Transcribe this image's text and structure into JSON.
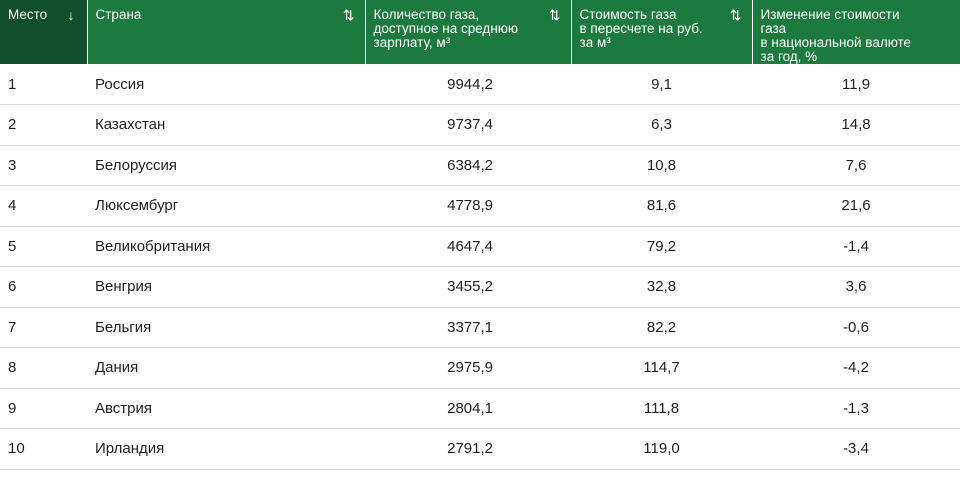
{
  "chart_data": {
    "type": "table",
    "columns": [
      {
        "label": "Место",
        "icon": "arrow-down-icon"
      },
      {
        "label": "Страна",
        "icon": "sort-arrows-icon"
      },
      {
        "label": "Количество газа,\nдоступное на среднюю\nзарплату, м³",
        "icon": "sort-arrows-icon"
      },
      {
        "label": "Стоимость газа\nв пересчете на руб.\nза м³",
        "icon": "sort-arrows-icon"
      },
      {
        "label": "Изменение стоимости газа\nв национальной валюте\nза год, %",
        "icon": ""
      }
    ],
    "rows": [
      [
        "1",
        "Россия",
        "9944,2",
        "9,1",
        "11,9"
      ],
      [
        "2",
        "Казахстан",
        "9737,4",
        "6,3",
        "14,8"
      ],
      [
        "3",
        "Белоруссия",
        "6384,2",
        "10,8",
        "7,6"
      ],
      [
        "4",
        "Люксембург",
        "4778,9",
        "81,6",
        "21,6"
      ],
      [
        "5",
        "Великобритания",
        "4647,4",
        "79,2",
        "-1,4"
      ],
      [
        "6",
        "Венгрия",
        "3455,2",
        "32,8",
        "3,6"
      ],
      [
        "7",
        "Бельгия",
        "3377,1",
        "82,2",
        "-0,6"
      ],
      [
        "8",
        "Дания",
        "2975,9",
        "114,7",
        "-4,2"
      ],
      [
        "9",
        "Австрия",
        "2804,1",
        "111,8",
        "-1,3"
      ],
      [
        "10",
        "Ирландия",
        "2791,2",
        "119,0",
        "-3,4"
      ]
    ]
  },
  "colors": {
    "header_bg": "#1d7a3e",
    "header_active_bg": "#0f4f2a",
    "header_text": "#ffffff",
    "row_border": "#d9d9d9"
  }
}
